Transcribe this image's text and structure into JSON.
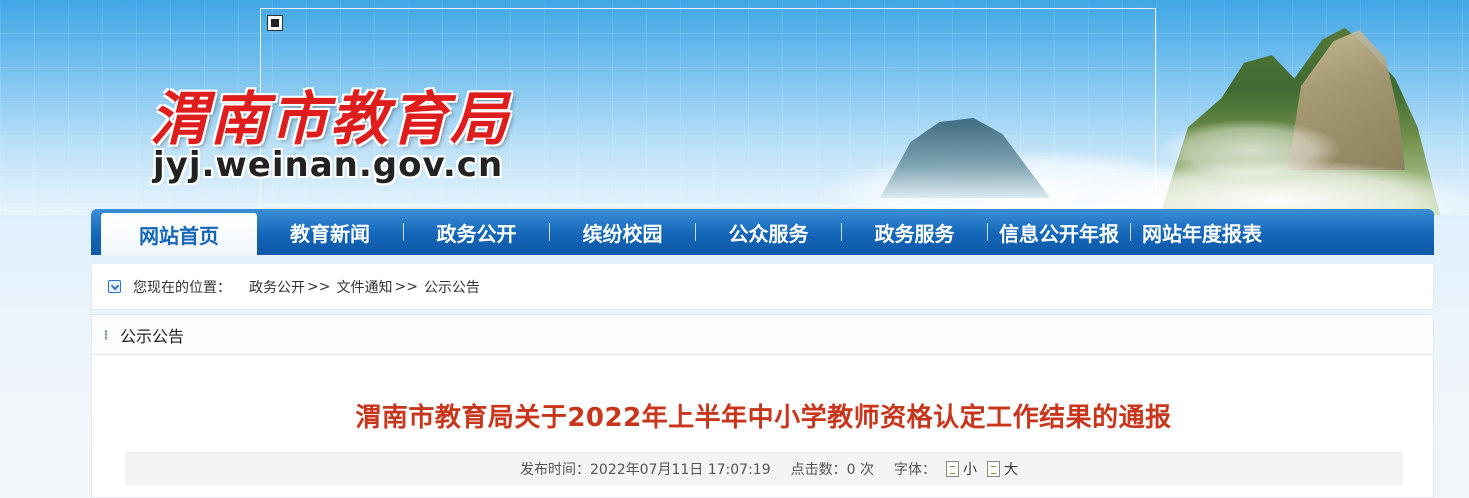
{
  "header": {
    "site_title": "渭南市教育局",
    "site_domain": "jyj.weinan.gov.cn"
  },
  "nav": {
    "items": [
      {
        "label": "网站首页",
        "active": true
      },
      {
        "label": "教育新闻"
      },
      {
        "label": "政务公开"
      },
      {
        "label": "缤纷校园"
      },
      {
        "label": "公众服务"
      },
      {
        "label": "政务服务"
      },
      {
        "label": "信息公开年报"
      },
      {
        "label": "网站年度报表"
      }
    ]
  },
  "breadcrumb": {
    "prefix": "您现在的位置：",
    "items": [
      "政务公开",
      "文件通知",
      "公示公告"
    ],
    "separator": ">>"
  },
  "panel": {
    "title": "公示公告"
  },
  "article": {
    "title": "渭南市教育局关于2022年上半年中小学教师资格认定工作结果的通报",
    "publish_label": "发布时间：",
    "publish_time": "2022年07月11日 17:07:19",
    "clicks_label": "点击数：",
    "clicks_value": "0 次",
    "font_label": "字体：",
    "font_small": "小",
    "font_large": "大"
  },
  "colors": {
    "nav_blue": "#1466b8",
    "title_red": "#c8361c",
    "logo_red": "#e01d1d"
  }
}
